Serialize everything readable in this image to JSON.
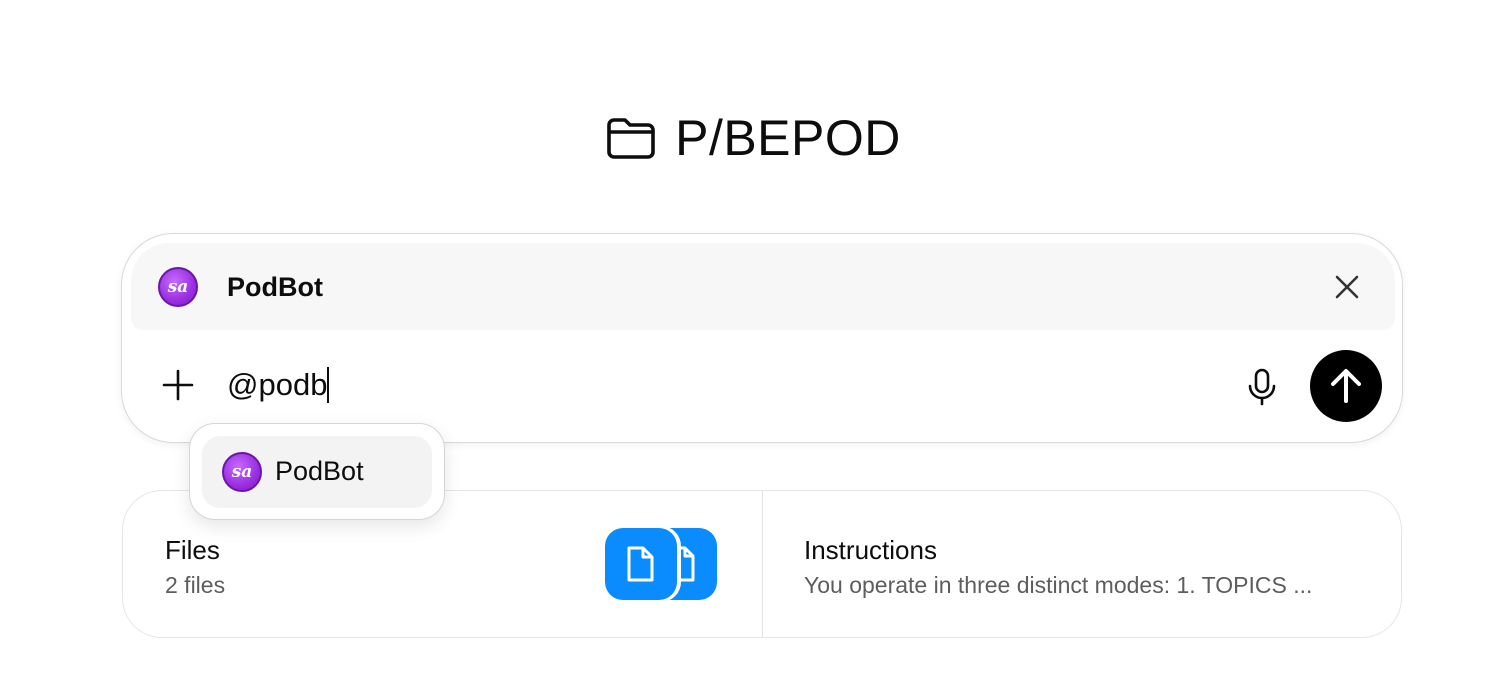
{
  "project": {
    "title": "P/BEPOD",
    "icon": "folder-icon"
  },
  "composer": {
    "mention": {
      "name": "PodBot",
      "avatar_text": "sa",
      "close_icon": "close-icon"
    },
    "input": {
      "value": "@podb"
    },
    "icons": {
      "add": "plus-icon",
      "mic": "microphone-icon",
      "send": "arrow-up-icon"
    }
  },
  "dropdown": {
    "options": [
      {
        "label": "PodBot",
        "avatar_text": "sa"
      }
    ]
  },
  "cards": {
    "files": {
      "title": "Files",
      "subtitle": "2 files",
      "icon": "file-icon"
    },
    "instructions": {
      "title": "Instructions",
      "subtitle": "You operate in three distinct modes: 1. TOPICS ..."
    }
  },
  "colors": {
    "accent_blue": "#0a8cff",
    "avatar_purple": "#9b2fe0",
    "send_button": "#000000"
  }
}
